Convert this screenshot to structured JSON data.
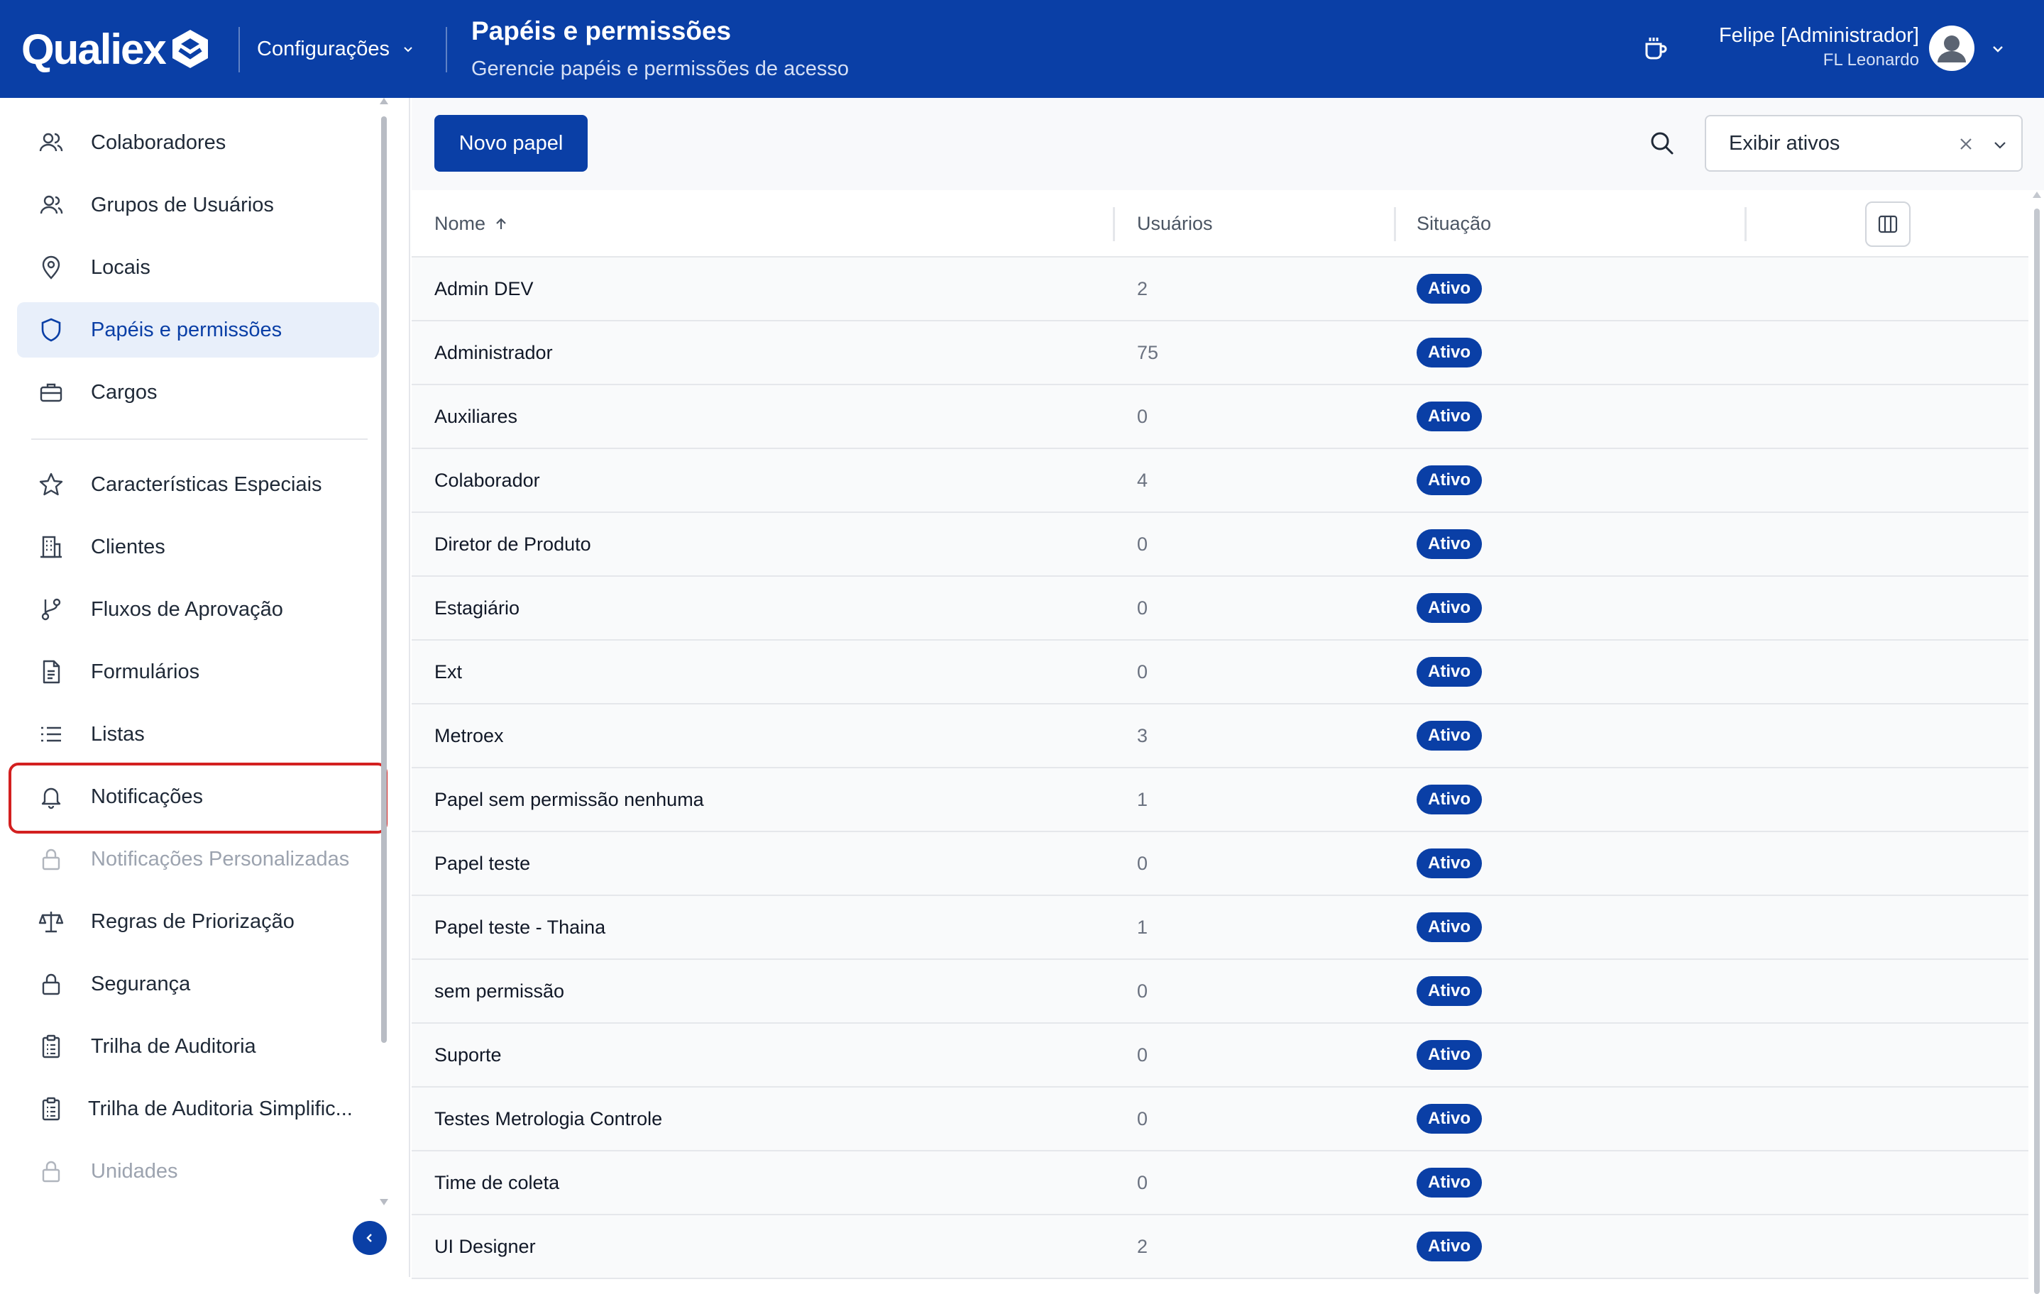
{
  "brand": {
    "name": "Qualiex"
  },
  "header": {
    "module": "Configurações",
    "title": "Papéis e permissões",
    "subtitle": "Gerencie papéis e permissões de acesso",
    "user_name": "Felipe [Administrador]",
    "user_org": "FL Leonardo"
  },
  "sidebar": {
    "items": [
      {
        "label": "Colaboradores",
        "icon": "users-icon"
      },
      {
        "label": "Grupos de Usuários",
        "icon": "user-group-icon"
      },
      {
        "label": "Locais",
        "icon": "map-pin-icon"
      },
      {
        "label": "Papéis e permissões",
        "icon": "shield-icon",
        "active": true
      },
      {
        "label": "Cargos",
        "icon": "briefcase-icon"
      },
      {
        "label": "Características Especiais",
        "icon": "star-icon"
      },
      {
        "label": "Clientes",
        "icon": "building-icon"
      },
      {
        "label": "Fluxos de Aprovação",
        "icon": "git-branch-icon"
      },
      {
        "label": "Formulários",
        "icon": "document-icon"
      },
      {
        "label": "Listas",
        "icon": "list-icon"
      },
      {
        "label": "Notificações",
        "icon": "bell-icon",
        "highlighted": true
      },
      {
        "label": "Notificações Personalizadas",
        "icon": "lock-icon",
        "disabled": true
      },
      {
        "label": "Regras de Priorização",
        "icon": "scale-icon"
      },
      {
        "label": "Segurança",
        "icon": "lock-icon"
      },
      {
        "label": "Trilha de Auditoria",
        "icon": "clipboard-icon"
      },
      {
        "label": "Trilha de Auditoria Simplific...",
        "icon": "clipboard-icon"
      },
      {
        "label": "Unidades",
        "icon": "lock-icon",
        "disabled": true
      }
    ]
  },
  "toolbar": {
    "new_button": "Novo papel",
    "filter_value": "Exibir ativos"
  },
  "table": {
    "columns": {
      "name": "Nome",
      "users": "Usuários",
      "status": "Situação"
    },
    "rows": [
      {
        "name": "Admin DEV",
        "users": "2",
        "status": "Ativo"
      },
      {
        "name": "Administrador",
        "users": "75",
        "status": "Ativo"
      },
      {
        "name": "Auxiliares",
        "users": "0",
        "status": "Ativo"
      },
      {
        "name": "Colaborador",
        "users": "4",
        "status": "Ativo"
      },
      {
        "name": "Diretor de Produto",
        "users": "0",
        "status": "Ativo"
      },
      {
        "name": "Estagiário",
        "users": "0",
        "status": "Ativo"
      },
      {
        "name": "Ext",
        "users": "0",
        "status": "Ativo"
      },
      {
        "name": "Metroex",
        "users": "3",
        "status": "Ativo"
      },
      {
        "name": "Papel sem permissão nenhuma",
        "users": "1",
        "status": "Ativo"
      },
      {
        "name": "Papel teste",
        "users": "0",
        "status": "Ativo"
      },
      {
        "name": "Papel teste - Thaina",
        "users": "1",
        "status": "Ativo"
      },
      {
        "name": "sem permissão",
        "users": "0",
        "status": "Ativo"
      },
      {
        "name": "Suporte",
        "users": "0",
        "status": "Ativo"
      },
      {
        "name": "Testes Metrologia Controle",
        "users": "0",
        "status": "Ativo"
      },
      {
        "name": "Time de coleta",
        "users": "0",
        "status": "Ativo"
      },
      {
        "name": "UI Designer",
        "users": "2",
        "status": "Ativo"
      }
    ]
  },
  "colors": {
    "primary": "#0a3fa6",
    "highlight": "#d32020",
    "active_bg": "#e8effa"
  }
}
